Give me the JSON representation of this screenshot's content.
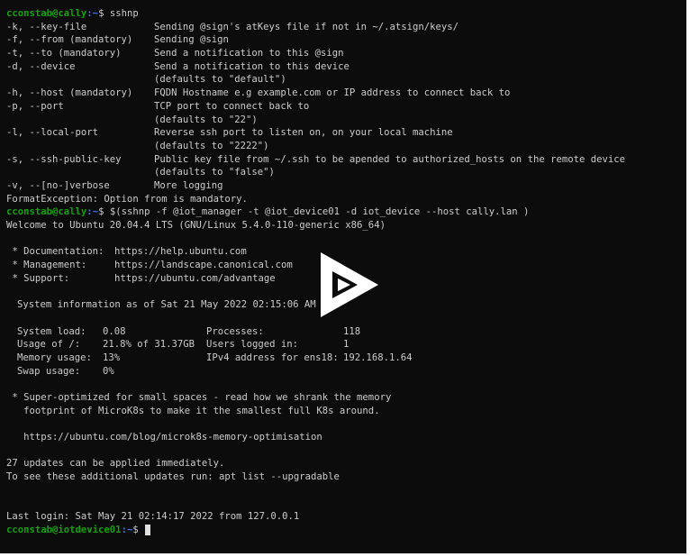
{
  "prompt": {
    "user_host": "cconstab@cally",
    "path": ":~",
    "symbol": "$"
  },
  "prompt2": {
    "user_host": "cconstab@iotdevice01",
    "path": ":~",
    "symbol": "$"
  },
  "cmd1": "sshnp",
  "help": [
    {
      "opt": "-k, --key-file",
      "desc": "Sending @sign's atKeys file if not in ~/.atsign/keys/"
    },
    {
      "opt": "-f, --from (mandatory)",
      "desc": "Sending @sign"
    },
    {
      "opt": "-t, --to (mandatory)",
      "desc": "Send a notification to this @sign"
    },
    {
      "opt": "-d, --device",
      "desc": "Send a notification to this device"
    },
    {
      "opt": "",
      "desc": "(defaults to \"default\")"
    },
    {
      "opt": "-h, --host (mandatory)",
      "desc": "FQDN Hostname e.g example.com or IP address to connect back to"
    },
    {
      "opt": "-p, --port",
      "desc": "TCP port to connect back to"
    },
    {
      "opt": "",
      "desc": "(defaults to \"22\")"
    },
    {
      "opt": "-l, --local-port",
      "desc": "Reverse ssh port to listen on, on your local machine"
    },
    {
      "opt": "",
      "desc": "(defaults to \"2222\")"
    },
    {
      "opt": "-s, --ssh-public-key",
      "desc": "Public key file from ~/.ssh to be apended to authorized_hosts on the remote device"
    },
    {
      "opt": "",
      "desc": "(defaults to \"false\")"
    },
    {
      "opt": "-v, --[no-]verbose",
      "desc": "More logging"
    }
  ],
  "error": "FormatException: Option from is mandatory.",
  "cmd2": "$(sshnp -f @iot_manager -t @iot_device01 -d iot_device --host cally.lan )",
  "welcome": "Welcome to Ubuntu 20.04.4 LTS (GNU/Linux 5.4.0-110-generic x86_64)",
  "links": [
    {
      "label": " * Documentation:",
      "url": "https://help.ubuntu.com"
    },
    {
      "label": " * Management:",
      "url": "https://landscape.canonical.com"
    },
    {
      "label": " * Support:",
      "url": "https://ubuntu.com/advantage"
    }
  ],
  "sysinfo_title": "System information as of Sat 21 May 2022 02:15:06 AM UTC",
  "stats": [
    {
      "k1": "System load:",
      "v1": "0.08",
      "k2": "Processes:",
      "v2": "118"
    },
    {
      "k1": "Usage of /:",
      "v1": "21.8% of 31.37GB",
      "k2": "Users logged in:",
      "v2": "1"
    },
    {
      "k1": "Memory usage:",
      "v1": "13%",
      "k2": "IPv4 address for ens18:",
      "v2": "192.168.1.64"
    },
    {
      "k1": "Swap usage:",
      "v1": "0%",
      "k2": "",
      "v2": ""
    }
  ],
  "promo1": " * Super-optimized for small spaces - read how we shrank the memory",
  "promo2": "   footprint of MicroK8s to make it the smallest full K8s around.",
  "promo_url": "   https://ubuntu.com/blog/microk8s-memory-optimisation",
  "updates1": "27 updates can be applied immediately.",
  "updates2": "To see these additional updates run: apt list --upgradable",
  "last_login": "Last login: Sat May 21 02:14:17 2022 from 127.0.0.1",
  "colors": {
    "background": "#0c0c0c",
    "text": "#cccccc",
    "user": "#13a10e",
    "path": "#3b78ff"
  },
  "icons": {
    "overlay": "play-icon"
  }
}
